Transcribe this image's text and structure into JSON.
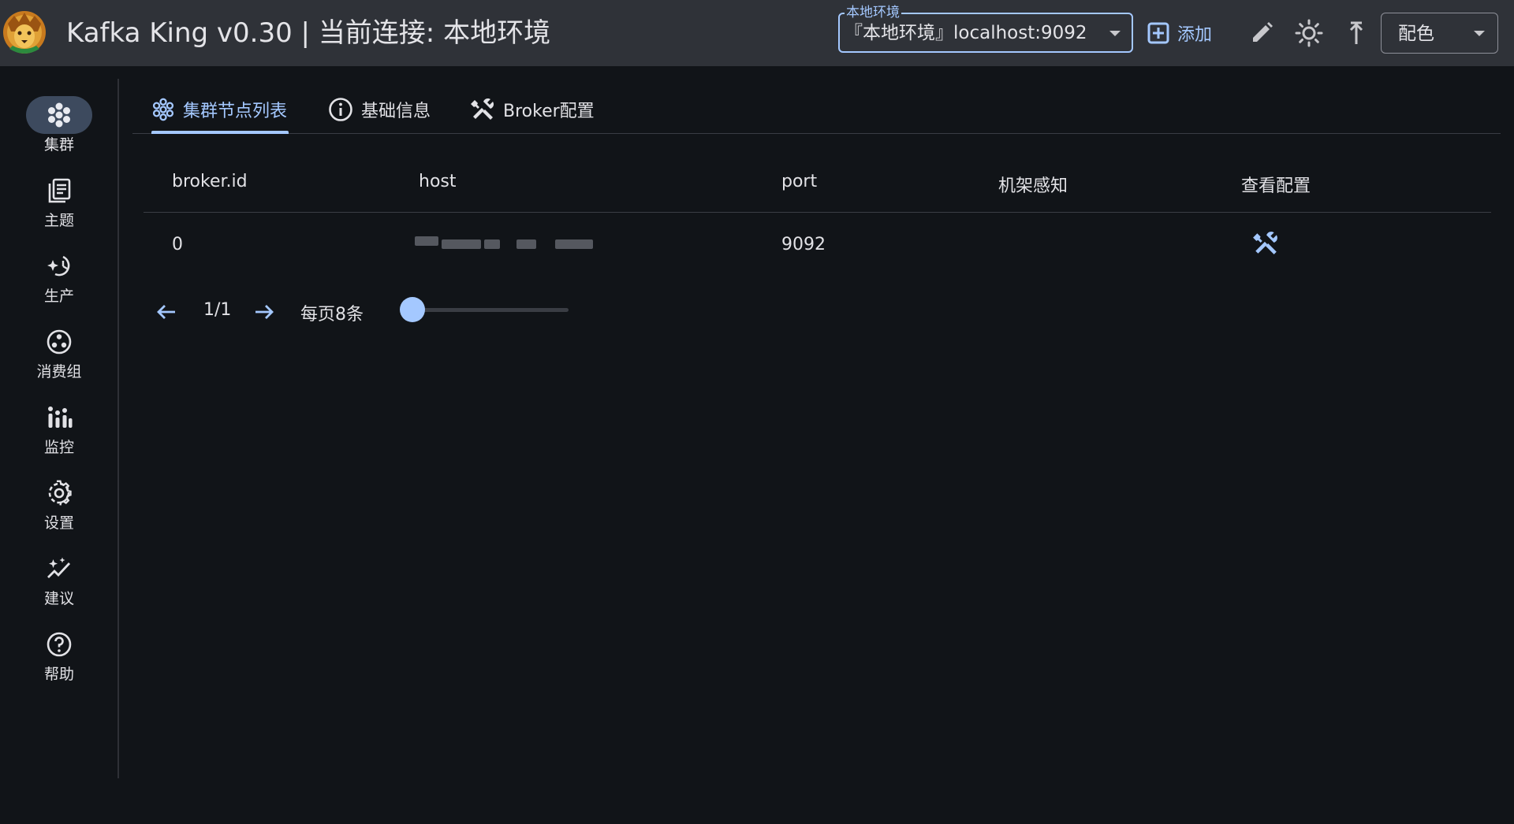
{
  "header": {
    "title": "Kafka King v0.30 | 当前连接: 本地环境",
    "connection_legend": "本地环境",
    "connection_value": "『本地环境』localhost:9092",
    "add_label": "添加",
    "theme_label": "配色"
  },
  "sidebar": {
    "items": [
      {
        "label": "集群",
        "icon": "cluster-icon"
      },
      {
        "label": "主题",
        "icon": "topic-icon"
      },
      {
        "label": "生产",
        "icon": "produce-icon"
      },
      {
        "label": "消费组",
        "icon": "consumer-group-icon"
      },
      {
        "label": "监控",
        "icon": "monitor-icon"
      },
      {
        "label": "设置",
        "icon": "gear-icon"
      },
      {
        "label": "建议",
        "icon": "suggestion-icon"
      },
      {
        "label": "帮助",
        "icon": "help-icon"
      }
    ],
    "active_index": 0
  },
  "tabs": [
    {
      "label": "集群节点列表",
      "icon": "cluster-icon"
    },
    {
      "label": "基础信息",
      "icon": "info-icon"
    },
    {
      "label": "Broker配置",
      "icon": "tools-icon"
    }
  ],
  "table": {
    "columns": [
      "broker.id",
      "host",
      "port",
      "机架感知",
      "查看配置"
    ],
    "rows": [
      {
        "broker_id": "0",
        "port": "9092",
        "rack": ""
      }
    ]
  },
  "pagination": {
    "page_text": "1/1",
    "per_page_text": "每页8条",
    "slider_fraction": 0.0
  },
  "colors": {
    "accent": "#a4c8ff",
    "background": "#111418",
    "topbar": "#2f3238"
  }
}
